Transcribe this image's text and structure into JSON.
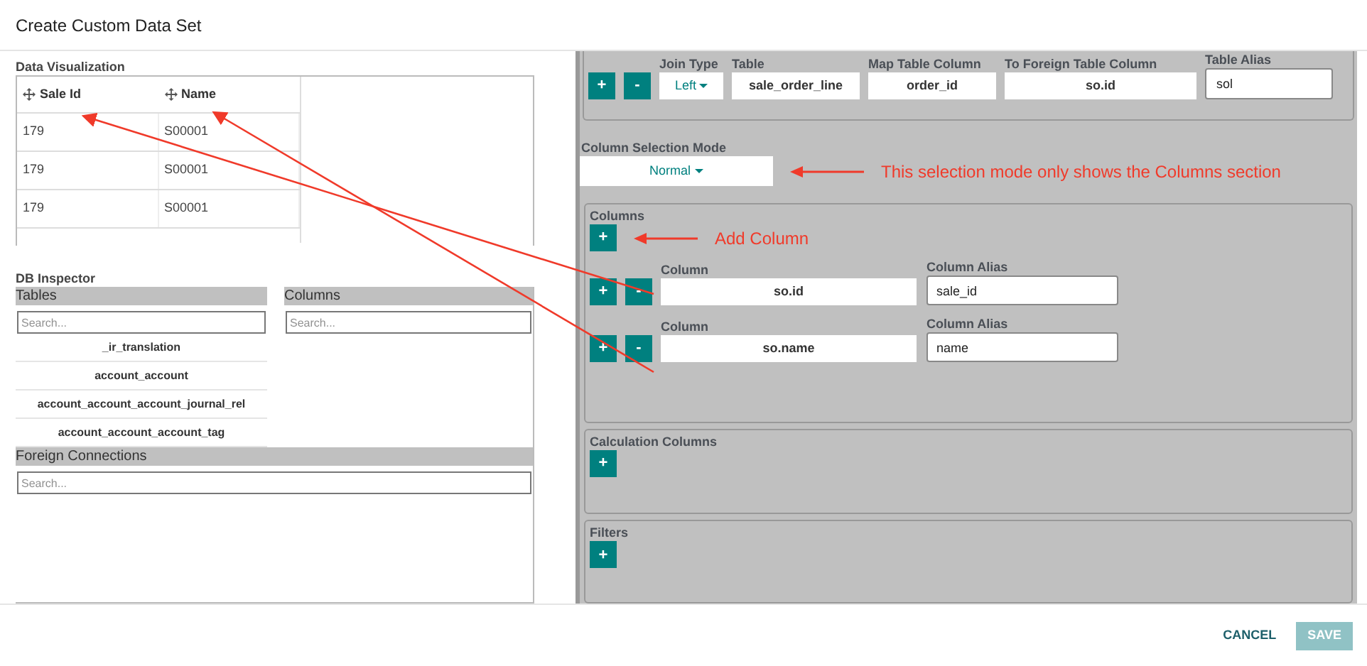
{
  "title": "Create Custom Data Set",
  "data_visualization": {
    "label": "Data Visualization",
    "columns": [
      "Sale Id",
      "Name"
    ],
    "rows": [
      [
        "179",
        "S00001"
      ],
      [
        "179",
        "S00001"
      ],
      [
        "179",
        "S00001"
      ]
    ]
  },
  "db_inspector": {
    "label": "DB Inspector",
    "tables_header": "Tables",
    "columns_header": "Columns",
    "tables_search": {
      "placeholder": "Search..."
    },
    "columns_search": {
      "placeholder": "Search..."
    },
    "tables": [
      "_ir_translation",
      "account_account",
      "account_account_account_journal_rel",
      "account_account_account_tag"
    ],
    "foreign_header": "Foreign Connections",
    "foreign_search": {
      "placeholder": "Search..."
    }
  },
  "join_row": {
    "buttons": [
      "+",
      "-"
    ],
    "fields": [
      {
        "label": "Join Type",
        "value": "Left",
        "kind": "dropdown"
      },
      {
        "label": "Table",
        "value": "sale_order_line",
        "kind": "display"
      },
      {
        "label": "Map Table Column",
        "value": "order_id",
        "kind": "display"
      },
      {
        "label": "To Foreign Table Column",
        "value": "so.id",
        "kind": "display"
      },
      {
        "label": "Table Alias",
        "value": "sol",
        "kind": "input"
      }
    ]
  },
  "column_selection_mode": {
    "label": "Column Selection Mode",
    "value": "Normal",
    "note": "This selection mode only shows the Columns section"
  },
  "columns_section": {
    "title": "Columns",
    "add_button": "+",
    "note": "Add Column",
    "rows": [
      {
        "buttons": [
          "+",
          "-"
        ],
        "column_label": "Column",
        "column_value": "so.id",
        "alias_label": "Column Alias",
        "alias_value": "sale_id"
      },
      {
        "buttons": [
          "+",
          "-"
        ],
        "column_label": "Column",
        "column_value": "so.name",
        "alias_label": "Column Alias",
        "alias_value": "name"
      }
    ]
  },
  "calculation_columns": {
    "title": "Calculation Columns",
    "add_button": "+"
  },
  "filters": {
    "title": "Filters",
    "add_button": "+"
  },
  "footer": [
    {
      "label": "CANCEL",
      "kind": "text",
      "disabled": false
    },
    {
      "label": "SAVE",
      "kind": "primary",
      "disabled": true
    }
  ]
}
